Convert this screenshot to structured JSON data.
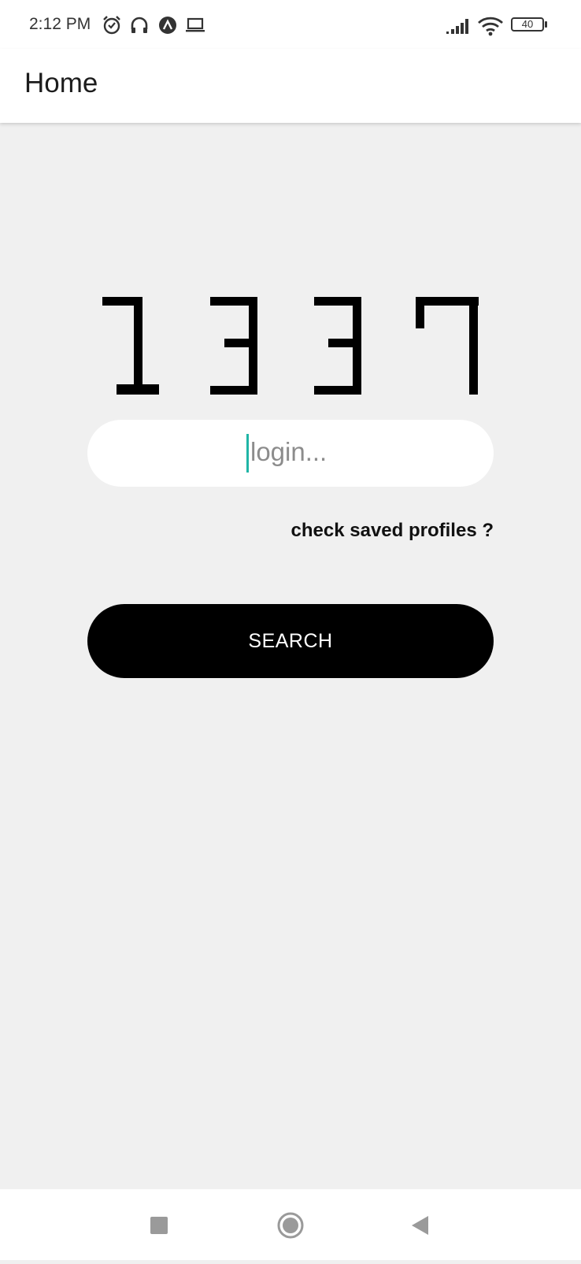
{
  "status_bar": {
    "time": "2:12 PM",
    "battery_level": "40",
    "icons": [
      "alarm-icon",
      "headphones-icon",
      "app-notification-icon",
      "laptop-icon",
      "signal-icon",
      "wifi-icon",
      "battery-icon"
    ]
  },
  "app_bar": {
    "title": "Home"
  },
  "logo": {
    "text": "1337"
  },
  "login": {
    "placeholder": "login..."
  },
  "saved_profiles_link": "check saved profiles ?",
  "search_button": "SEARCH",
  "nav_bar": {
    "icons": [
      "recents-square-icon",
      "home-circle-icon",
      "back-triangle-icon"
    ]
  },
  "colors": {
    "background": "#f0f0f0",
    "accent_cursor": "#1fb5a6",
    "button": "#000000"
  }
}
